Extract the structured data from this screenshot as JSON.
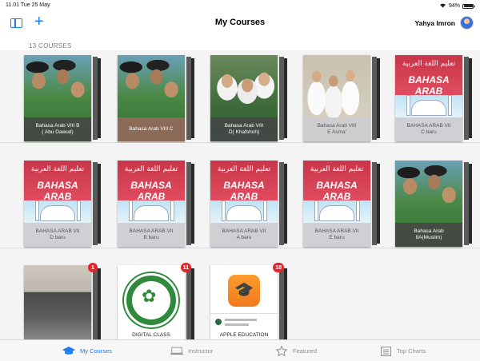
{
  "status_bar": {
    "time_date": "11.01  Tue 25 May",
    "battery_text": "94%",
    "battery_level": 0.94
  },
  "nav": {
    "title": "My Courses",
    "sidebar_icon": "sidebar-icon",
    "add_icon": "plus-icon",
    "add_label": "+",
    "user_name": "Yahya Imron"
  },
  "course_count": "13 COURSES",
  "courses": [
    {
      "line1": "Bahasa Arab VIII B",
      "line2": "( Abu Dawud)",
      "cover": "photo-students",
      "badge": ""
    },
    {
      "line1": "Bahasa Arab VIII C",
      "line2": "",
      "cover": "photo-students",
      "badge": ""
    },
    {
      "line1": "Bahasa Arab VIII",
      "line2": "D( Khafshoh)",
      "cover": "photo-hijab",
      "badge": ""
    },
    {
      "line1": "Bahasa Arab VIII",
      "line2": "E Asma'",
      "cover": "photo-hijab-white",
      "badge": ""
    },
    {
      "line1": "BAHASA ARAB VII",
      "line2": "C baru",
      "cover": "bahasa-arab-book",
      "badge": ""
    },
    {
      "line1": "BAHASA ARAB VII",
      "line2": "D baru",
      "cover": "bahasa-arab-book",
      "badge": ""
    },
    {
      "line1": "BAHASA ARAB VII",
      "line2": "B baru",
      "cover": "bahasa-arab-book",
      "badge": ""
    },
    {
      "line1": "BAHASA ARAB VII",
      "line2": "A  baru",
      "cover": "bahasa-arab-book",
      "badge": ""
    },
    {
      "line1": "BAHASA ARAB VII",
      "line2": "E baru",
      "cover": "bahasa-arab-book",
      "badge": ""
    },
    {
      "line1": "Bahasa Arab",
      "line2": "8A(Muslim)",
      "cover": "photo-students",
      "badge": ""
    },
    {
      "line1": "",
      "line2": "",
      "cover": "photo-room",
      "badge": "1"
    },
    {
      "line1": "DIGITAL CLASS",
      "line2": "",
      "cover": "school-logo",
      "badge": "11"
    },
    {
      "line1": "APPLE EDUCATION",
      "line2": "",
      "cover": "apple-education",
      "badge": "18"
    }
  ],
  "book_cover_text": {
    "arabic": "تعليم اللغة العربية",
    "title": "BAHASA ARAB"
  },
  "logo_text": "LEMBAGA PENDIDIKAN ISLAM",
  "tabs": [
    {
      "label": "My Courses",
      "icon": "graduation-cap-icon",
      "active": true
    },
    {
      "label": "Instructor",
      "icon": "laptop-icon",
      "active": false
    },
    {
      "label": "Featured",
      "icon": "star-icon",
      "active": false
    },
    {
      "label": "Top Charts",
      "icon": "list-icon",
      "active": false
    }
  ],
  "colors": {
    "accent": "#1a7cf5",
    "badge": "#e8232a",
    "book_red": "#c8364a"
  }
}
